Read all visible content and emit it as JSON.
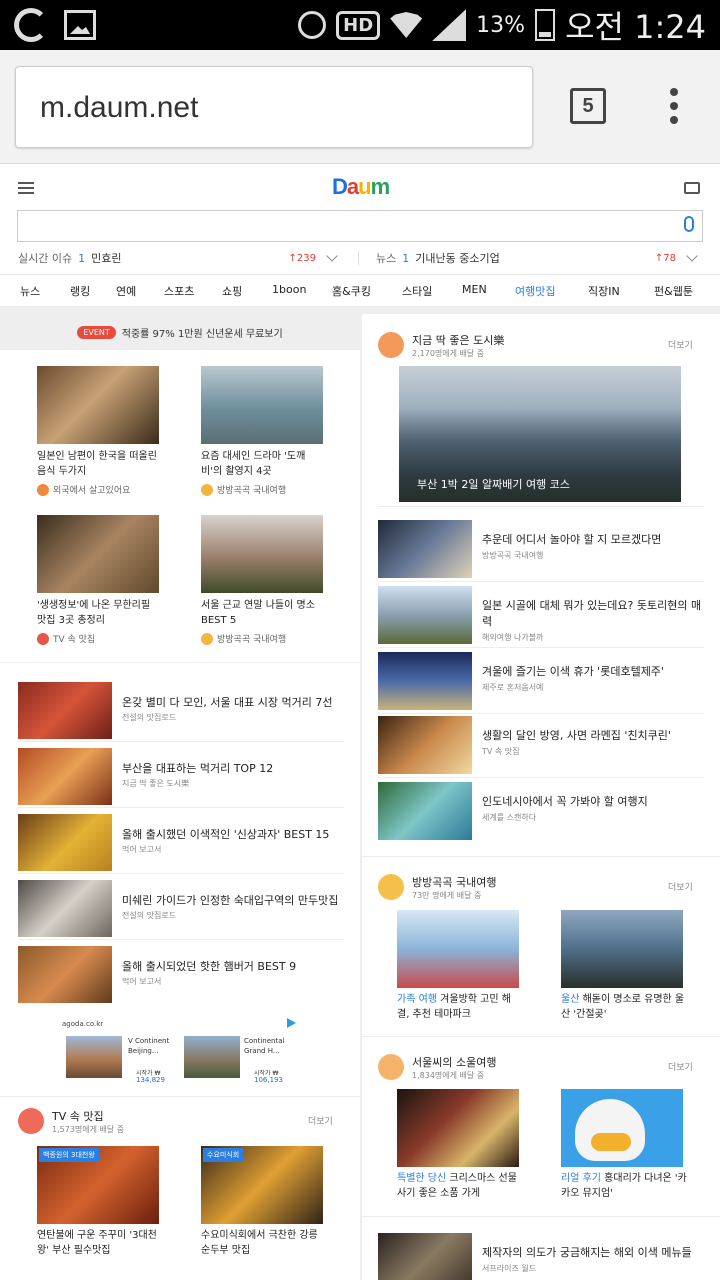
{
  "status_bar": {
    "battery": "13%",
    "time": "오전 1:24",
    "hd_label": "HD"
  },
  "browser": {
    "url": "m.daum.net",
    "tab_count": "5"
  },
  "header": {
    "logo": [
      "D",
      "a",
      "u",
      "m",
      ""
    ],
    "logo_text": "Daum",
    "trends": [
      {
        "label": "실시간 이슈",
        "num": "1",
        "keyword": "민효린",
        "change": "↑239"
      },
      {
        "label": "뉴스",
        "num": "1",
        "keyword": "기내난동 중소기업",
        "change": "↑78"
      }
    ],
    "nav": [
      "뉴스",
      "랭킹",
      "연예",
      "스포츠",
      "쇼핑",
      "1boon",
      "홈&쿠킹",
      "스타일",
      "MEN",
      "여행맛집",
      "직장IN",
      "펀&웹툰"
    ]
  },
  "left": {
    "event": {
      "badge": "EVENT",
      "text": "적중률 97% 1만원 신년운세 무료보기"
    },
    "cards": [
      {
        "title": "일본인 남편이 한국을 떠올린 음식 두가지",
        "source": "외국에서 살고있어요"
      },
      {
        "title": "요즘 대세인 드라마 '도깨비'의 촬영지 4곳",
        "source": "방방곡곡 국내여행"
      },
      {
        "title": "'생생정보'에 나온 무한리필 맛집 3곳 총정리",
        "source": "TV 속 맛집"
      },
      {
        "title": "서울 근교 연말 나들이 명소 BEST 5",
        "source": "방방곡곡 국내여행"
      }
    ],
    "list": [
      {
        "title": "온갖 별미 다 모인, 서울 대표 시장 먹거리 7선",
        "source": "전설의 맛집로드"
      },
      {
        "title": "부산을 대표하는 먹거리 TOP 12",
        "source": "지금 딱 좋은 도시樂"
      },
      {
        "title": "올해 출시했던 이색적인 '신상과자' BEST 15",
        "source": "먹어 보고서"
      },
      {
        "title": "미쉐린 가이드가 인정한 숙대입구역의 만두맛집",
        "source": "전설의 맛집로드"
      },
      {
        "title": "올해 출시되었던 핫한 햄버거 BEST 9",
        "source": "먹어 보고서"
      }
    ],
    "ad": {
      "domain": "agoda.co.kr",
      "items": [
        {
          "name": "V Continent Beijing...",
          "price_label": "시작가 ₩",
          "price": "134,829"
        },
        {
          "name": "Continental Grand H...",
          "price_label": "시작가 ₩",
          "price": "106,193"
        }
      ]
    },
    "tv_section": {
      "name": "TV 속 맛집",
      "sub": "1,573명에게 배달 중",
      "more": "더보기",
      "items": [
        {
          "badge": "백종원의 3대천왕",
          "title": "연탄불에 구운 주꾸미 '3대천왕' 부산 필수맛집"
        },
        {
          "badge": "수요미식회",
          "title": "수요미식회에서 극찬한 강릉 순두부 맛집"
        }
      ]
    }
  },
  "right": {
    "section1": {
      "name": "지금 딱 좋은 도시樂",
      "sub": "2,170명에게 배달 중",
      "more": "더보기",
      "hero_caption": "부산 1박 2일 알짜배기 여행 코스",
      "rows": [
        {
          "title": "추운데 어디서 놀아야 할 지 모르겠다면",
          "source": "방방곡곡 국내여행"
        },
        {
          "title": "일본 시골에 대체 뭐가 있는데요? 돗토리현의 매력",
          "source": "해외여행 나가볼까"
        },
        {
          "title": "겨울에 즐기는 이색 휴가 '롯데호텔제주'",
          "source": "제주로 혼저옵서예"
        },
        {
          "title": "생활의 달인 방영, 사면 라멘집 '친치쿠린'",
          "source": "TV 속 맛집"
        },
        {
          "title": "인도네시아에서 꼭 가봐야 할 여행지",
          "source": "세계를 스캔하다"
        }
      ]
    },
    "section2": {
      "name": "방방곡곡 국내여행",
      "sub": "73만 명에게 배달 중",
      "more": "더보기",
      "items": [
        {
          "tag": "가족 여행",
          "title": "겨울방학 고민 해결, 추천 테마파크"
        },
        {
          "tag": "울산",
          "title": "해돋이 명소로 유명한 울산 '간절곶'"
        }
      ]
    },
    "section3": {
      "name": "서울씨의 소울여행",
      "sub": "1,834명에게 배달 중",
      "more": "더보기",
      "items": [
        {
          "tag": "특별한 당신",
          "title": "크리스마스 선물 사기 좋은 소품 가게"
        },
        {
          "tag": "리얼 후기",
          "title": "홍대리가 다녀온 '카카오 뮤지엄'"
        }
      ]
    },
    "last_row": {
      "title": "제작자의 의도가 궁금해지는 해외 이색 메뉴들",
      "source": "서프라이즈 월드"
    }
  }
}
